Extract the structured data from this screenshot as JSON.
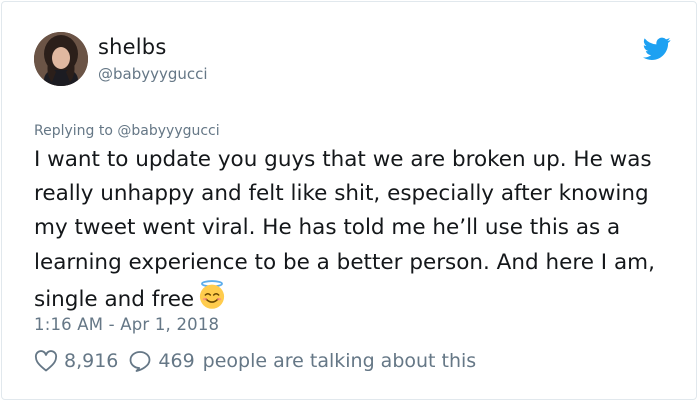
{
  "tweet": {
    "display_name": "shelbs",
    "handle": "@babyyygucci",
    "replying_prefix": "Replying to",
    "replying_handle": "@babyyygucci",
    "text": "I want to update you guys that we are broken up. He was really unhappy and felt like shit, especially after knowing my tweet went viral. He has told me he’ll use this as a learning experience to be a better person. And here I am, single and free",
    "emoji_icon": "smiling-face-with-halo-icon",
    "timestamp": "1:16 AM - Apr 1, 2018",
    "likes": "8,916",
    "replies_count": "469",
    "talking_label": "people are talking about this"
  },
  "colors": {
    "brand": "#1da1f2",
    "text": "#14171a",
    "muted": "#657786",
    "border": "#e1e8ed"
  }
}
